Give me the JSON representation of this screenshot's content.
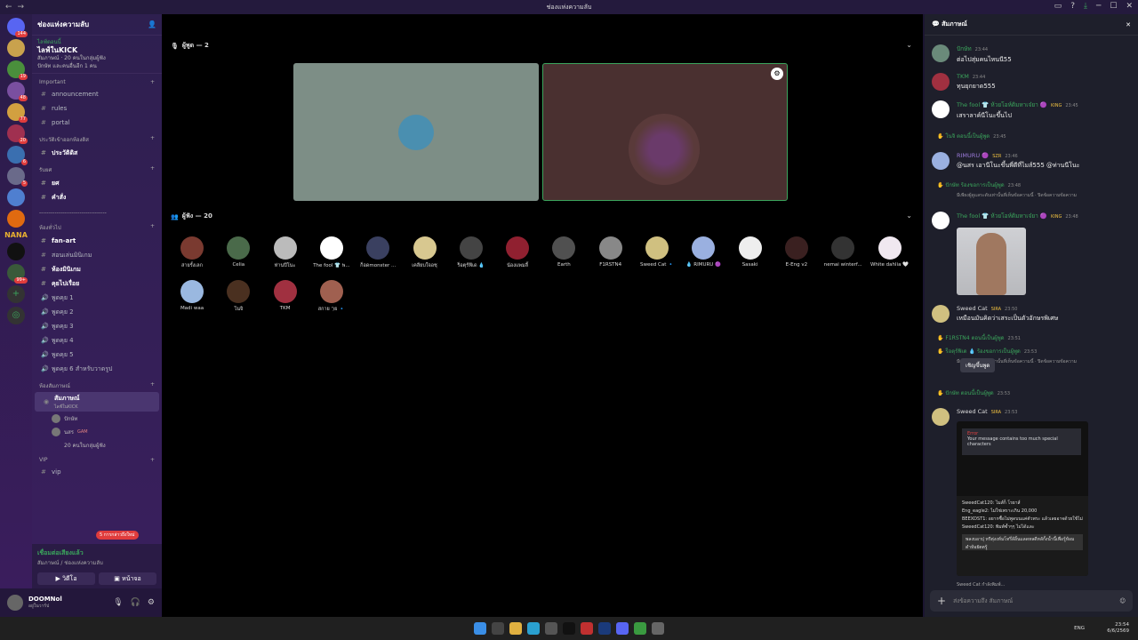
{
  "window": {
    "title": "ช่องแห่งความลับ"
  },
  "servers": [
    {
      "badge": "144",
      "color": "#5865f2"
    },
    {
      "badge": "",
      "color": "#c9a24d"
    },
    {
      "badge": "19",
      "color": "#4a8f3c"
    },
    {
      "badge": "48",
      "color": "#7a4fa0"
    },
    {
      "badge": "77",
      "color": "#d2a040"
    },
    {
      "badge": "20",
      "color": "#a03050"
    },
    {
      "badge": "6",
      "color": "#3a6fb0"
    },
    {
      "badge": "5",
      "color": "#6a6a8a"
    },
    {
      "badge": "",
      "color": "#4f7fd0"
    },
    {
      "badge": "",
      "color": "#e06a10"
    },
    {
      "badge": "",
      "color": "#111"
    },
    {
      "badge": "99+",
      "color": "#3a5a3a"
    }
  ],
  "nana": "NANA",
  "guild": {
    "name": "ช่องแห่งความลับ"
  },
  "event": {
    "live": "ไลฟ์ตอนนี้",
    "title": "ไลฟ์ในKICK",
    "info": "สัมภาษณ์ · 20 คนในกลุ่มผู้ฟัง",
    "line": "ปักษัท และคนอื่นอีก 1 คน"
  },
  "categories": [
    {
      "name": "Important",
      "channels": [
        "announcement",
        "rules",
        "portal"
      ]
    },
    {
      "name": "ประวัติเข้าออกห้องดิส",
      "channels": [
        "ประวัติดิส"
      ]
    },
    {
      "name": "รับยศ",
      "channels": [
        "ยศ",
        "คำสั่ง"
      ]
    }
  ],
  "divider": "-----------------------------------",
  "general": {
    "name": "ห้องทั่วไป",
    "channels": [
      "fan-art",
      "สอนเล่นมินิเกม",
      "ห้องมินิเกม",
      "คุยไปเรื่อย"
    ]
  },
  "voice": [
    "พูดคุย 1",
    "พูดคุย 2",
    "พูดคุย 3",
    "พูดคุย 4",
    "พูดคุย 5",
    "พูดคุย 6 สำหรับวาดรูป"
  ],
  "stage": {
    "cat": "ห้องสัมภาษณ์",
    "name": "สัมภาษณ์",
    "sub": "ไลฟ์ในKICK",
    "m1": "ปักษัท",
    "m2": "นสร",
    "m2tag": "GAM",
    "listeners": "20 คนในกลุ่มผู้ฟัง"
  },
  "vip": {
    "cat": "VIP",
    "ch": "vip",
    "ch2": "VIP",
    "mention": "5 การกล่าวถึงใหม่"
  },
  "voice_status": {
    "title": "เชื่อมต่อเสียงแล้ว",
    "sub": "สัมภาษณ์ / ช่องแห่งความลับ",
    "video": "วิดีโอ",
    "screen": "หน้าจอ"
  },
  "user": {
    "name": "DOOMNol",
    "status": "อยู่ในวาร์ป"
  },
  "main": {
    "speakers": "ผู้พูด — 2",
    "listeners": "ผู้ฟัง — 20"
  },
  "audience": [
    {
      "n": "สายรั้งเลก",
      "c": "#7a3a30"
    },
    {
      "n": "Celia",
      "c": "#4a6a4a"
    },
    {
      "n": "ท่านปีโนะ",
      "c": "#bbb"
    },
    {
      "n": "The fool 👕 พ...",
      "c": "#fff"
    },
    {
      "n": "ก็อดmonster ...",
      "c": "#3a4060"
    },
    {
      "n": "เคลียบใจอชุ",
      "c": "#d8c890"
    },
    {
      "n": "ร็อตุร์ฟิเด 💧",
      "c": "#444"
    },
    {
      "n": "น้องแพมลี้",
      "c": "#902030"
    },
    {
      "n": "Earth",
      "c": "#505050"
    },
    {
      "n": "F1RSTN4",
      "c": "#888"
    },
    {
      "n": "Sweed Cat 🔹",
      "c": "#d0c080"
    },
    {
      "n": "💧 RIMURU 🟣",
      "c": "#9ab0e0"
    },
    {
      "n": "Sasaki",
      "c": "#eee"
    },
    {
      "n": "E-Eng v2",
      "c": "#3a2020"
    },
    {
      "n": "nemai winterf...",
      "c": "#333"
    },
    {
      "n": "White dahlia 🤍",
      "c": "#f0e8f0"
    },
    {
      "n": "Madi waa",
      "c": "#9ab8e0"
    },
    {
      "n": "โนจิ",
      "c": "#4a3020"
    },
    {
      "n": "TKM",
      "c": "#a03040"
    },
    {
      "n": "สกาย ')ย 🔹",
      "c": "#a06050"
    }
  ],
  "chat": {
    "title": "สัมภาษณ์",
    "messages": [
      {
        "name": "ปักษัท",
        "color": "#3ba55c",
        "time": "23:44",
        "text": "ต่อไปสุ่มคนไหนนี55",
        "avc": "#6a8a7a"
      },
      {
        "name": "TKM",
        "color": "#3ba55c",
        "time": "23:44",
        "text": "ทุนยุกยาด555",
        "avc": "#a03040"
      },
      {
        "name": "The fool 👕 ห้วยโอห์ดิมหาเจ๋ยา 🟣",
        "color": "#3ba55c",
        "tag": "KING",
        "time": "23:45",
        "text": "เสราลาค์นีโนะขึ้นไป",
        "avc": "#fff"
      },
      {
        "name": "RIMURU 🟣",
        "color": "#9b7ad8",
        "tag": "SZR",
        "time": "23:46",
        "text": "@นสร เอานีโนะขึ้นพี่ดีที่ไมส์555 @ท่านนีโนะ",
        "avc": "#9ab0e0"
      },
      {
        "name": "The fool 👕 ห้วยโอห์ดิมหาเจ๋ยา 🟣",
        "color": "#3ba55c",
        "tag": "KING",
        "time": "23:48",
        "text": "",
        "avc": "#fff"
      },
      {
        "name": "Sweed Cat",
        "color": "#ddd",
        "tag": "SIRA",
        "time": "23:50",
        "text": "เหมือนมันคิดว่าเสระเป็นตัวอักษรพิเศษ",
        "avc": "#d0c080"
      },
      {
        "name": "Sweed Cat",
        "color": "#ddd",
        "tag": "SIRA",
        "time": "23:53",
        "text": "",
        "avc": "#d0c080"
      }
    ],
    "sys": [
      {
        "text": "โนจิ ตอนนี้เป็นผู้พูด",
        "time": "23:45"
      },
      {
        "text": "ปักษัท ร้องขอการเป็นผู้พูด",
        "time": "23:48",
        "note": "มีเพียงผู้ดูแลระดับเท่านั้นที่เห็นข้อความนี้ · ปิดข้อความข้อความ"
      },
      {
        "text": "F1RSTN4 ตอนนี้เป็นผู้พูด",
        "time": "23:51"
      },
      {
        "text": "ร็อตุร์ฟิเด 💧 ร้องขอการเป็นผู้พูด",
        "time": "23:53",
        "note": "มีเพียงผู้ดูแลระดับเท่านั้นที่เห็นข้อความนี้ · ปิดข้อความข้อความ"
      },
      {
        "text": "ปักษัท ตอนนี้เป็นผู้พูด",
        "time": "23:53"
      }
    ],
    "invite": "เชิญขึ้นพูด",
    "shot": {
      "err": "Error",
      "errmsg": "Your message contains too much special characters",
      "l1": "SweedCat120: ไมส์ก็ โรยาส์",
      "l2": "Eng_eagle2: ไม่ใช่เพราะเกิน 20,000",
      "l3": "BEEXDST1: อยากซื้อไม่พูดบนแค่ตัวพระ แล้วเลยอาจด้วยใช้ไม่",
      "l4": "SweedCat120: พิมพ์ซ้ำๆๆ ไม่ได้และ",
      "input": "พลงบอาปุ หรีตุ่งงห์มโทรึ่ล้อิ้นแลดหลดีหลักั้งน้ำนี้เพื่อรู้ห้อมดำห้อยัตตรู้",
      "typing": "Sweed Cat กำลังพิมพ์..."
    },
    "compose": "ส่งข้อความถึง สัมภาษณ์"
  },
  "tray": {
    "lang": "ENG",
    "time": "23:54",
    "date": "6/6/2569"
  }
}
